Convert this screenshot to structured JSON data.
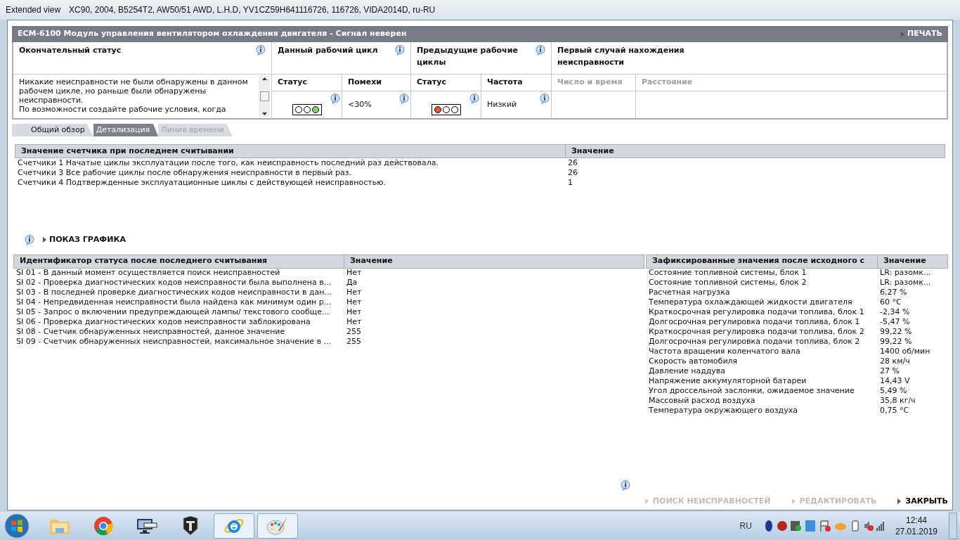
{
  "window": {
    "title": "Extended view",
    "subtitle": "XC90, 2004, B5254T2, AW50/51 AWD, L.H.D, YV1CZ59H641116726, 116726, VIDA2014D, ru-RU"
  },
  "header": {
    "title": "ECM-6100 Модуль управления вентилятором охлаждения двигателя - Сигнал неверен",
    "print": "ПЕЧАТЬ"
  },
  "status": {
    "final_title": "Окончательный статус",
    "final_text": [
      "Никакие неисправности не были обнаружены в данном рабочем цикле, но раньше были обнаружены неисправности.",
      "По возможности создайте рабочие условия, когда"
    ],
    "current": {
      "title": "Данный рабочий цикл",
      "status_label": "Статус",
      "second_label": "Помехи",
      "second_value": "<30%",
      "lights": [
        {
          "color": "#ffffff"
        },
        {
          "color": "#ffffff"
        },
        {
          "color": "#7ed86f"
        }
      ]
    },
    "previous": {
      "title": "Предыдущие рабочие циклы",
      "status_label": "Статус",
      "second_label": "Частота",
      "second_value": "Низкий",
      "lights": [
        {
          "color": "#f0582c"
        },
        {
          "color": "#ffffff"
        },
        {
          "color": "#ffffff"
        }
      ]
    },
    "first": {
      "title": "Первый случай нахождения неисправности",
      "columns": [
        {
          "label": "Число и время",
          "disabled": true
        },
        {
          "label": "Расстояние",
          "disabled": true
        }
      ]
    }
  },
  "tabs": [
    {
      "label": "Общий обзор",
      "selected": false,
      "disabled": false
    },
    {
      "label": "Детализация",
      "selected": true,
      "disabled": false
    },
    {
      "label": "Линия времени",
      "selected": false,
      "disabled": true
    }
  ],
  "counters": {
    "columns": [
      "Значение счетчика при последнем считывании",
      "Значение"
    ],
    "rows": [
      [
        "Счетчики 1 Начатые циклы эксплуатации после того, как неисправность последний раз действовала.",
        "26"
      ],
      [
        "Счетчики 3 Все рабочие циклы после обнаружения неисправности в первый раз.",
        "26"
      ],
      [
        "Счетчики 4 Подтвержденные эксплуатационные циклы с действующей неисправностью.",
        "1"
      ]
    ]
  },
  "graph_link": "ПОКАЗ ГРАФИКА",
  "status_ids": {
    "columns": [
      "Идентификатор статуса после последнего считывания",
      "Значение"
    ],
    "rows": [
      [
        "SI 01 - В данный момент осуществляется поиск неисправностей",
        "Нет"
      ],
      [
        "SI 02 - Проверка диагностических кодов неисправности была выполнена в...",
        "Да"
      ],
      [
        "SI 03 - В последней проверке диагностических кодов неисправности в дан...",
        "Нет"
      ],
      [
        "SI 04 - Непредвиденная неисправности была найдена как минимум один р...",
        "Нет"
      ],
      [
        "SI 05 - Запрос о включении предупреждающей лампы/ текстового сообще...",
        "Нет"
      ],
      [
        "SI 06 - Проверка диагностических кодов неисправности заблокирована",
        "Нет"
      ],
      [
        "SI 08 - Счетчик обнаруженных неисправностей, данное значение",
        "255"
      ],
      [
        "SI 09 - Счетчик обнаруженных неисправностей, максимальное значение в ...",
        "255"
      ]
    ]
  },
  "freeze_frame": {
    "columns": [
      "Зафиксированные значения после исходного с",
      "Значение"
    ],
    "rows": [
      [
        "Состояние топливной системы, блок 1",
        "LR: разомк..."
      ],
      [
        "Состояние топливной системы, блок 2",
        "LR: разомк..."
      ],
      [
        "Расчетная нагрузка",
        "6,27 %"
      ],
      [
        "Температура охлаждающей жидкости двигателя",
        "60 °C"
      ],
      [
        "Краткосрочная регулировка подачи топлива, блок 1",
        "-2,34 %"
      ],
      [
        "Долгосрочная регулировка подачи топлива, блок 1",
        "-5,47 %"
      ],
      [
        "Краткосрочная регулировка подачи топлива, блок 2",
        "99,22 %"
      ],
      [
        "Долгосрочная регулировка подачи топлива, блок 2",
        "99,22 %"
      ],
      [
        "Частота вращения коленчатого вала",
        "1400 об/мин"
      ],
      [
        "Скорость автомобиля",
        "28 км/ч"
      ],
      [
        "Давление наддува",
        "27 %"
      ],
      [
        "Напряжение аккумуляторной батареи",
        "14,43 V"
      ],
      [
        "Угол дроссельной заслонки, ожидаемое значение",
        "5,49 %"
      ],
      [
        "Массовый расход воздуха",
        "35,8 кг/ч"
      ],
      [
        "Температура окружающего воздуха",
        "0,75 °C"
      ]
    ]
  },
  "actions": [
    {
      "label": "ПОИСК НЕИСПРАВНОСТЕЙ",
      "disabled": true
    },
    {
      "label": "РЕДАКТИРОВАТЬ",
      "disabled": true
    },
    {
      "label": "ЗАКРЫТЬ",
      "disabled": false
    }
  ],
  "taskbar": {
    "apps": [
      {
        "kind": "folder",
        "selected": false
      },
      {
        "kind": "chrome",
        "selected": false
      },
      {
        "kind": "monitor",
        "selected": false
      },
      {
        "kind": "tank",
        "selected": false
      },
      {
        "kind": "ie",
        "selected": true
      },
      {
        "kind": "paint",
        "selected": true
      }
    ],
    "language": "RU",
    "time": "12:44",
    "date": "27.01.2019"
  }
}
